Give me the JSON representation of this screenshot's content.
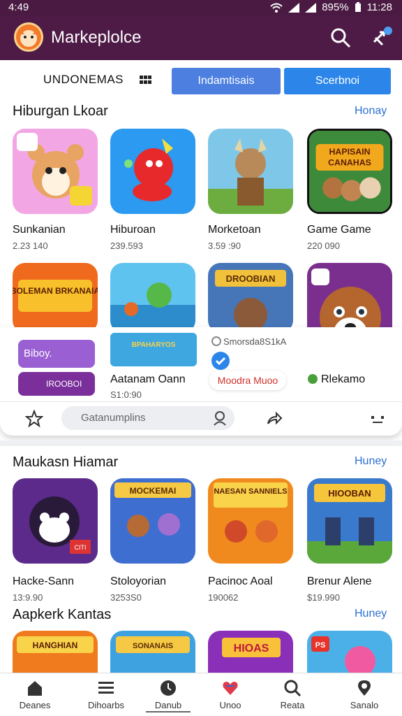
{
  "status_bar": {
    "time": "4:49",
    "battery": "895%",
    "clock": "11:28"
  },
  "app_bar": {
    "title": "Markeplolce",
    "search_icon": "search-icon",
    "more_icon": "share-icon"
  },
  "filter_bar": {
    "region_label": "UNDONEMAS",
    "button1": "Indamtisais",
    "button2": "Scerbnoi"
  },
  "section1": {
    "title": "Hiburgan Lkoar",
    "more": "Honay",
    "apps": [
      {
        "name": "Sunkanian",
        "meta": "2.23 140"
      },
      {
        "name": "Hiburoan",
        "meta": "239.593"
      },
      {
        "name": "Morketoan",
        "meta": "3.59 :90"
      },
      {
        "name": "Game Game",
        "meta": "220 090"
      }
    ],
    "row2_banners": [
      "BOLEMAN BRKANAIA",
      "DROOBIAN"
    ]
  },
  "popup": {
    "chip1": "Biboy.",
    "chip2": "IROOBOI",
    "banner_text": "BPAHARYOS",
    "item1_name": "Aatanam Oann",
    "item1_meta": "S1:0:90",
    "item2_status": "Smorsda8S1kA",
    "item2_name": "Moodra Muoo",
    "item3_name": "Rlekamo",
    "search_text": "Gatanumplins"
  },
  "section2": {
    "title": "Maukasn Hiamar",
    "more": "Huney",
    "apps": [
      {
        "name": "Hacke-Sann",
        "meta": "13:9.90",
        "badge": "CITI"
      },
      {
        "name": "Stoloyorian",
        "meta": "3253S0",
        "banner": "MOCKEMAI"
      },
      {
        "name": "Pacinoc Aoal",
        "meta": "190062",
        "banner": "NAESAN SANNIELS"
      },
      {
        "name": "Brenur Alene",
        "meta": "$19.990",
        "banner": "HIOOBAN"
      }
    ]
  },
  "section3": {
    "title": "Aapkerk Kantas",
    "more": "Huney",
    "banners": [
      "HANGHIAN",
      "SONANAIS",
      "HIOAS",
      "PS"
    ]
  },
  "bottom_nav": {
    "items": [
      {
        "label": "Deanes",
        "icon": "home-icon"
      },
      {
        "label": "Dihoarbs",
        "icon": "menu-icon"
      },
      {
        "label": "Danub",
        "icon": "clock-icon"
      },
      {
        "label": "Unoo",
        "icon": "heart-icon"
      },
      {
        "label": "Reata",
        "icon": "search-icon"
      },
      {
        "label": "Sanalo",
        "icon": "location-icon"
      }
    ]
  },
  "colors": {
    "appbar": "#4e1b47",
    "accent_blue": "#2c86ea",
    "link": "#2c6fd3"
  }
}
